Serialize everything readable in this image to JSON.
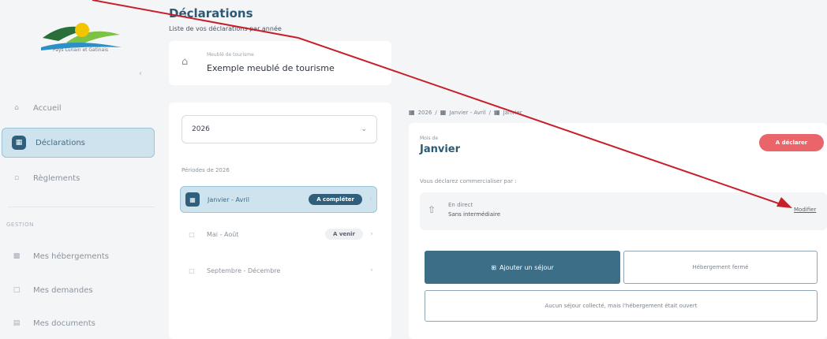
{
  "colors": {
    "primary": "#3d6e87",
    "title": "#2c5a74",
    "active_bg": "#cfe3ef",
    "danger": "#e9656a",
    "arrow": "#c81e28"
  },
  "sidebar": {
    "logo_text": "Pays Lunain et Gatinais",
    "collapse_icon": "chevron-left-icon",
    "items": [
      {
        "label": "Accueil",
        "icon": "home-icon"
      },
      {
        "label": "Déclarations",
        "icon": "document-icon"
      },
      {
        "label": "Règlements",
        "icon": "receipt-icon"
      }
    ],
    "section_label": "GESTION",
    "section_items": [
      {
        "label": "Mes hébergements",
        "icon": "building-icon"
      },
      {
        "label": "Mes demandes",
        "icon": "inbox-icon"
      },
      {
        "label": "Mes documents",
        "icon": "folder-icon"
      }
    ]
  },
  "header": {
    "title": "Déclarations",
    "subtitle": "Liste de vos déclarations par année"
  },
  "property": {
    "type": "Meublé de tourisme",
    "name": "Exemple meublé de tourisme"
  },
  "left": {
    "year": "2026",
    "periods_label": "Périodes de 2026",
    "periods": [
      {
        "label": "Janvier - Avril",
        "badge": "A compléter"
      },
      {
        "label": "Mai - Août",
        "badge": "A venir"
      },
      {
        "label": "Septembre - Décembre",
        "badge": ""
      }
    ]
  },
  "breadcrumb": {
    "year": "2026",
    "period": "Janvier - Avril",
    "month": "Janvier"
  },
  "detail": {
    "month_label": "Mois de",
    "month_name": "Janvier",
    "status": "A déclarer",
    "channel_label": "Vous déclarez commercialiser par :",
    "channel_name": "En direct",
    "channel_sub": "Sans intermédiaire",
    "modify_label": "Modifier",
    "add_stay_label": "Ajouter un séjour",
    "closed_label": "Hébergement fermé",
    "no_stay_label": "Aucun séjour collecté, mais l'hébergement était ouvert"
  }
}
